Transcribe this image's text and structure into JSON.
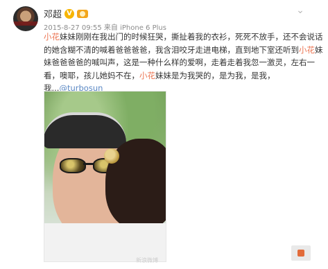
{
  "header": {
    "username": "邓超",
    "verified_badge": "V",
    "meta": "2015-8-27 09:55 来自 iPhone 6 Plus"
  },
  "post": {
    "line1": [
      {
        "text": "小花",
        "highlight": true
      },
      {
        "text": "妹妹刚刚在我出门的时候狂哭，撕扯着我的衣衫，死死不放手，还不会说话",
        "highlight": false
      }
    ],
    "line2": [
      {
        "text": "的她含糊不清的喊着爸爸爸爸，我含泪咬牙走进电梯，直到地下室还听到",
        "highlight": false
      },
      {
        "text": "小花",
        "highlight": true
      },
      {
        "text": "妹",
        "highlight": false
      }
    ],
    "line3": "妹爸爸爸爸的喊叫声，这是一种什么样的爱啊，走着走着我忽一激灵，左右一",
    "line4_a": "看，噢耶，孩儿她妈不在，",
    "line4_hl": "小花",
    "line4_b": "妹妹是为我哭的，是为我，是我，",
    "line5_a": "我...",
    "line5_mention": "@turbosun"
  },
  "photo": {
    "watermark": "新浪微博"
  },
  "icons": {
    "menu": "chevron-down-icon",
    "avatar": "avatar",
    "vip": "vip-badge-icon"
  },
  "colors": {
    "highlight": "#eb7350",
    "mention": "#5a88c4",
    "badge": "#f7b500"
  }
}
